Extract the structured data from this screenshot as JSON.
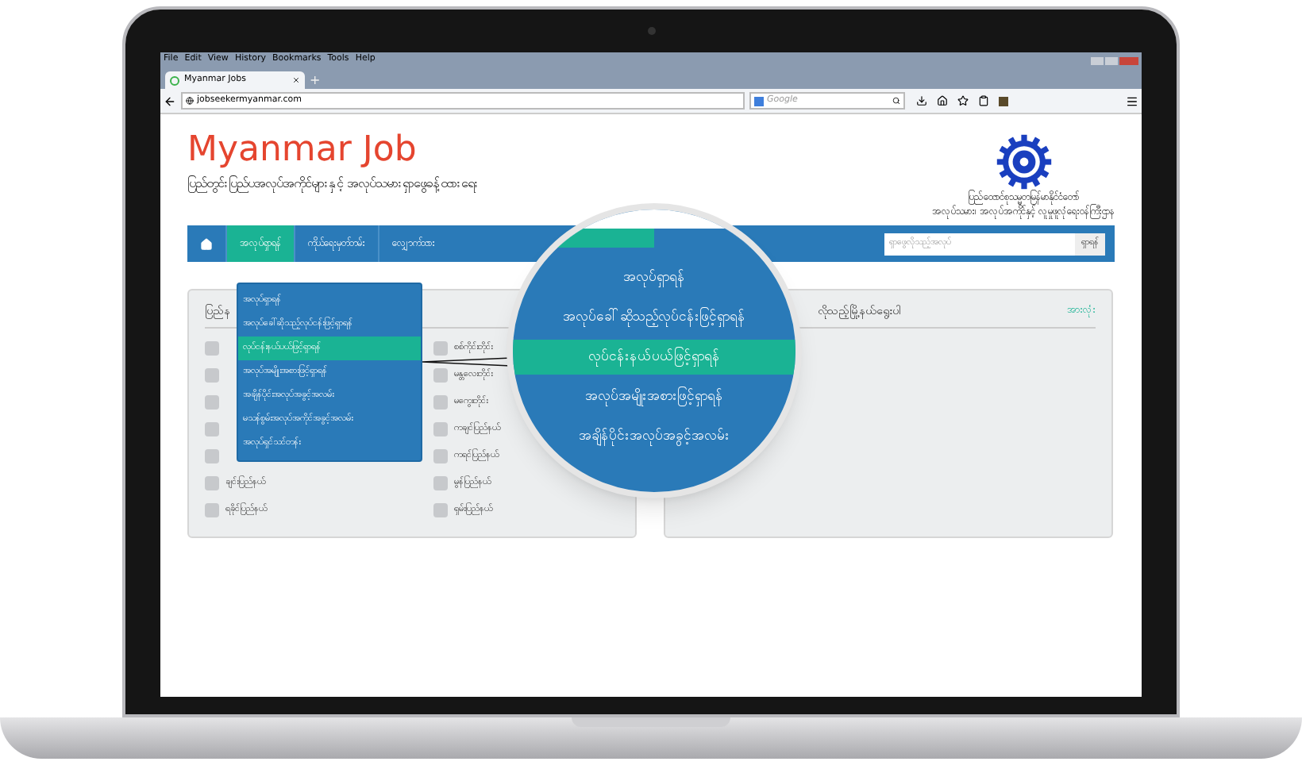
{
  "browser": {
    "menu": [
      "File",
      "Edit",
      "View",
      "History",
      "Bookmarks",
      "Tools",
      "Help"
    ],
    "tab": {
      "title": "Myanmar Jobs",
      "new_tab": "+"
    },
    "address": "jobseekermyanmar.com",
    "search_placeholder": "Google"
  },
  "header": {
    "title": "Myanmar Job",
    "subtitle": "ပြည်တွင်းပြည်ပအလုပ်အကိုင်များနှင့် အလုပ်သမားရှာဖွေခန့်ထားရေး",
    "ministry_lines": [
      "ပြည်ထောင်စုသမ္မတမြန်မာနိုင်ငံတော်",
      "အလုပ်သမား၊ အလုပ်အကိုင်နှင့် လူမှုဖူလုံရေးဝန်ကြီးဌာန"
    ]
  },
  "nav": {
    "items": [
      {
        "kind": "home",
        "selected": false
      },
      {
        "kind": "text",
        "label": "အလုပ်ရှာရန်",
        "selected": true
      },
      {
        "kind": "text",
        "label": "ကိုယ်ရေးမှတ်တမ်း",
        "selected": false
      },
      {
        "kind": "text",
        "label": "လျှောက်ထား",
        "selected": false
      }
    ],
    "search": {
      "placeholder": "ရှာဖွေလိုသည့်အလုပ်",
      "button": "ရှာရန်"
    }
  },
  "dropdown": {
    "items": [
      {
        "label": "အလုပ်ရှာရန်",
        "selected": false
      },
      {
        "label": "အလုပ်ခေါ်ဆိုသည့်လုပ်ငန်းဖြင့်ရှာရန်",
        "selected": false
      },
      {
        "label": "လုပ်ငန်းနယ်ပယ်ဖြင့်ရှာရန်",
        "selected": true
      },
      {
        "label": "အလုပ်အမျိုးအစားဖြင့်ရှာရန်",
        "selected": false
      },
      {
        "label": "အချိန်ပိုင်းအလုပ်အခွင့်အလမ်း",
        "selected": false
      },
      {
        "label": "မသန်စွမ်းအလုပ်အကိုင်အခွင့်အလမ်း",
        "selected": false
      },
      {
        "label": "အလုပ်ရှင်သင်တန်း",
        "selected": false
      }
    ]
  },
  "magnifier": {
    "items": [
      {
        "label": "အလုပ်ရှာရန်",
        "selected": false
      },
      {
        "label": "အလုပ်ခေါ်ဆိုသည့်လုပ်ငန်းဖြင့်ရှာရန်",
        "selected": false
      },
      {
        "label": "လုပ်ငန်းနယ်ပယ်ဖြင့်ရှာရန်",
        "selected": true
      },
      {
        "label": "အလုပ်အမျိုးအစားဖြင့်ရှာရန်",
        "selected": false
      },
      {
        "label": "အချိန်ပိုင်းအလုပ်အခွင့်အလမ်း",
        "selected": false
      }
    ]
  },
  "left_panel": {
    "title": "ပြည်န",
    "checkboxes": [
      {
        "checked": false
      },
      {
        "label": "စစ်ကိုင်းတိုင်း",
        "checked": false
      },
      {
        "checked": false
      },
      {
        "label": "မန္တလေးတိုင်း",
        "checked": false
      },
      {
        "checked": false
      },
      {
        "label": "မကွေးတိုင်း",
        "checked": false
      },
      {
        "checked": false
      },
      {
        "label": "ကချင်ပြည်နယ်",
        "checked": false
      },
      {
        "checked": false
      },
      {
        "label": "ကရင်ပြည်နယ်",
        "checked": false
      },
      {
        "label": "ချင်းပြည်နယ်",
        "checked": false
      },
      {
        "label": "မွန်ပြည်နယ်",
        "checked": false
      },
      {
        "label": "ရခိုင်ပြည်နယ်",
        "checked": false
      },
      {
        "label": "ရှမ်းပြည်နယ်",
        "checked": false
      }
    ]
  },
  "right_panel": {
    "title": "လိုသည့်မြို့နယ်ရွေးပါ",
    "link": "အားလုံး"
  }
}
